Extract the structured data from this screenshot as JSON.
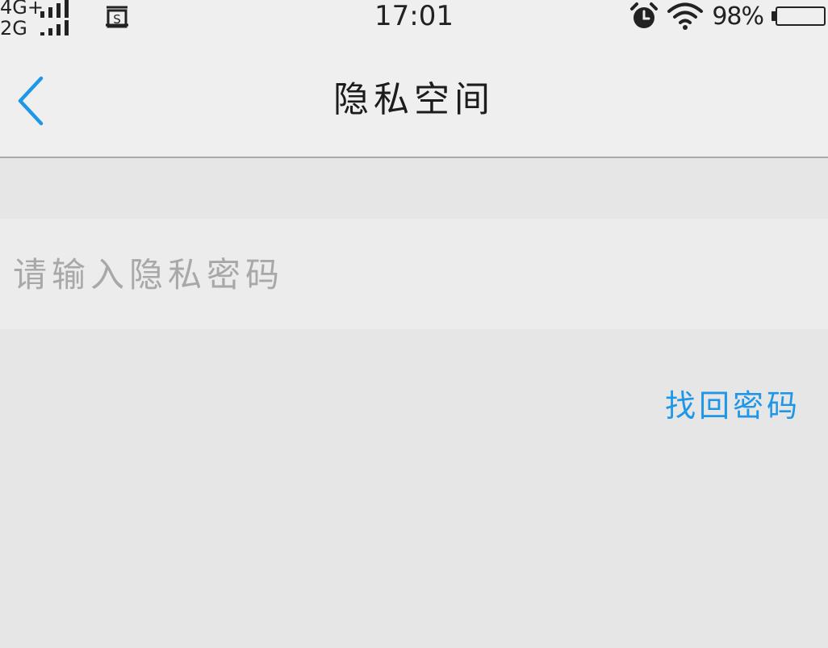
{
  "status_bar": {
    "network_top": "4G+",
    "network_bottom": "2G",
    "time": "17:01",
    "battery_percent": "98%",
    "battery_level": 0.98,
    "icons": [
      "signal-icon",
      "screenshot-icon",
      "alarm-icon",
      "wifi-icon",
      "battery-icon"
    ]
  },
  "nav": {
    "title": "隐私空间",
    "back_icon": "chevron-left-icon"
  },
  "form": {
    "password_placeholder": "请输入隐私密码",
    "password_value": ""
  },
  "links": {
    "forgot_password": "找回密码"
  },
  "colors": {
    "accent": "#1f97e8",
    "background": "#e6e6e6",
    "bar_background": "#efefef",
    "placeholder": "#a8a8a8"
  }
}
